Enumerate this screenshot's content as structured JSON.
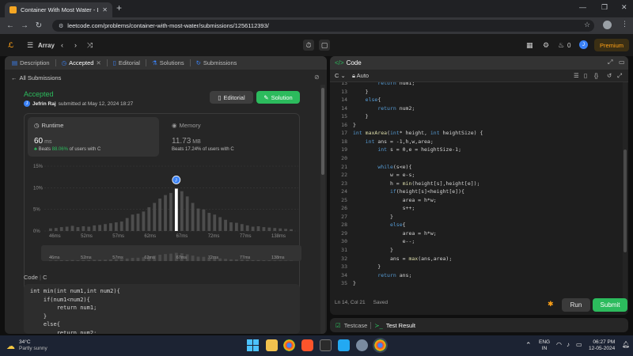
{
  "browser": {
    "tab_title": "Container With Most Water - Le",
    "url": "leetcode.com/problems/container-with-most-water/submissions/1256112393/"
  },
  "nav": {
    "problem_list": "Array",
    "streak": "0",
    "user_initial": "J",
    "premium": "Premium"
  },
  "left_tabs": [
    {
      "label": "Description",
      "active": false
    },
    {
      "label": "Accepted",
      "active": true
    },
    {
      "label": "Editorial",
      "active": false
    },
    {
      "label": "Solutions",
      "active": false
    },
    {
      "label": "Submissions",
      "active": false
    }
  ],
  "submission": {
    "all_submissions": "All Submissions",
    "status": "Accepted",
    "user": "Jefrin Raj",
    "submitted_text": "submitted at May 12, 2024 18:27",
    "editorial_btn": "Editorial",
    "solution_btn": "Solution"
  },
  "runtime": {
    "label": "Runtime",
    "value": "60",
    "unit": "ms",
    "beats_prefix": "Beats",
    "beats_pct": "88.06%",
    "beats_suffix": "of users with C"
  },
  "memory": {
    "label": "Memory",
    "value": "11.73",
    "unit": "MB",
    "beats_prefix": "Beats",
    "beats_pct": "17.24%",
    "beats_suffix": "of users with C"
  },
  "chart_data": {
    "type": "bar",
    "yticks": [
      "15%",
      "10%",
      "5%",
      "0%"
    ],
    "ylim": [
      0,
      15
    ],
    "xticks": [
      "46ms",
      "52ms",
      "57ms",
      "62ms",
      "67ms",
      "72ms",
      "77ms",
      "138ms"
    ],
    "values": [
      0.6,
      0.7,
      0.9,
      1.0,
      1.2,
      0.9,
      1.1,
      1.0,
      1.3,
      1.4,
      1.6,
      1.8,
      2.0,
      2.2,
      3.0,
      3.8,
      4.0,
      4.5,
      5.5,
      6.5,
      7.5,
      8.3,
      8.8,
      9.8,
      9.2,
      8.0,
      6.5,
      5.2,
      5.0,
      4.2,
      3.8,
      3.2,
      2.6,
      2.0,
      1.9,
      1.6,
      1.3,
      1.0,
      1.1,
      0.9,
      0.8,
      0.7,
      0.6,
      0.5,
      0.4
    ],
    "highlight_index": 23,
    "highlight_label": "J"
  },
  "left_code": {
    "header": "Code",
    "lang": "C",
    "lines": [
      "int min(int num1,int num2){",
      "    if(num1<num2){",
      "        return num1;",
      "    }",
      "    else{",
      "        return num2;"
    ]
  },
  "editor": {
    "title": "Code",
    "lang": "C",
    "mode": "Auto",
    "lines": [
      {
        "n": "13",
        "t": "        return num1;"
      },
      {
        "n": "13",
        "t": "    }"
      },
      {
        "n": "14",
        "t": "    else{"
      },
      {
        "n": "14",
        "t": "        return num2;"
      },
      {
        "n": "15",
        "t": "    }"
      },
      {
        "n": "16",
        "t": "}"
      },
      {
        "n": "17",
        "t": "int maxArea(int* height, int heightSize) {"
      },
      {
        "n": "18",
        "t": "    int ans = -1,h,w,area;"
      },
      {
        "n": "19",
        "t": "        int s = 0,e = heightSize-1;"
      },
      {
        "n": "20",
        "t": ""
      },
      {
        "n": "21",
        "t": "        while(s<e){"
      },
      {
        "n": "22",
        "t": "            w = e-s;"
      },
      {
        "n": "23",
        "t": "            h = min(height[s],height[e]);"
      },
      {
        "n": "24",
        "t": "            if(height[s]<height[e]){"
      },
      {
        "n": "25",
        "t": "                area = h*w;"
      },
      {
        "n": "26",
        "t": "                s++;"
      },
      {
        "n": "27",
        "t": "            }"
      },
      {
        "n": "28",
        "t": "            else{"
      },
      {
        "n": "29",
        "t": "                area = h*w;"
      },
      {
        "n": "30",
        "t": "                e--;"
      },
      {
        "n": "31",
        "t": "            }"
      },
      {
        "n": "32",
        "t": "            ans = max(ans,area);"
      },
      {
        "n": "33",
        "t": "        }"
      },
      {
        "n": "34",
        "t": "        return ans;"
      },
      {
        "n": "35",
        "t": "}"
      }
    ],
    "status_pos": "Ln 14, Col 21",
    "status_saved": "Saved",
    "run": "Run",
    "submit": "Submit"
  },
  "bottom": {
    "testcase": "Testcase",
    "test_result": "Test Result"
  },
  "taskbar": {
    "temp": "34°C",
    "weather": "Partly sunny",
    "lang1": "ENG",
    "lang2": "IN",
    "time": "06:27 PM",
    "date": "12-05-2024"
  }
}
